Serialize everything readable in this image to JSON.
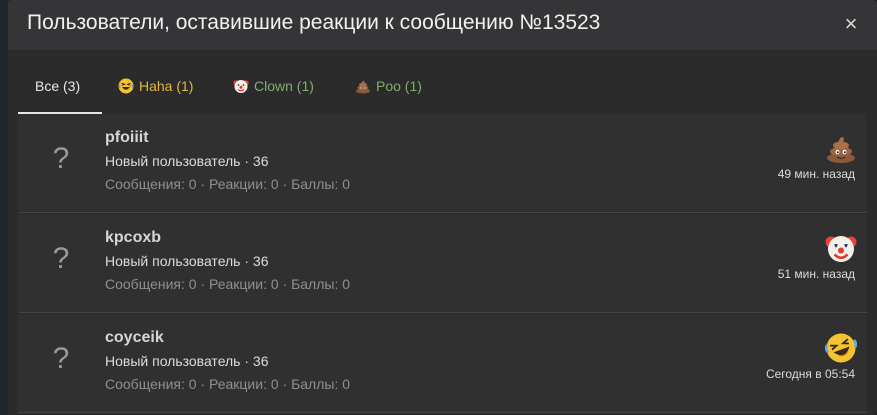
{
  "dialog": {
    "title": "Пользователи, оставившие реакции к сообщению №13523",
    "close_label": "×"
  },
  "tabs": [
    {
      "label": "Все (3)",
      "icon": null,
      "color": "#e8e8e8",
      "active": true
    },
    {
      "label": "Haha (1)",
      "icon": "haha-emoji",
      "color": "#e3b740",
      "active": false
    },
    {
      "label": "Clown (1)",
      "icon": "clown-emoji",
      "color": "#7fae6d",
      "active": false
    },
    {
      "label": "Poo (1)",
      "icon": "poo-emoji",
      "color": "#7fae6d",
      "active": false
    }
  ],
  "users": [
    {
      "avatar": "?",
      "name": "pfoiiit",
      "title": "Новый пользователь · 36",
      "stats": "Сообщения: 0 · Реакции: 0 · Баллы: 0",
      "reaction_icon": "poo-emoji",
      "time": "49 мин. назад"
    },
    {
      "avatar": "?",
      "name": "kpcoxb",
      "title": "Новый пользователь · 36",
      "stats": "Сообщения: 0 · Реакции: 0 · Баллы: 0",
      "reaction_icon": "clown-emoji",
      "time": "51 мин. назад"
    },
    {
      "avatar": "?",
      "name": "coyceik",
      "title": "Новый пользователь · 36",
      "stats": "Сообщения: 0 · Реакции: 0 · Баллы: 0",
      "reaction_icon": "haha-emoji",
      "time": "Сегодня в 05:54"
    }
  ]
}
